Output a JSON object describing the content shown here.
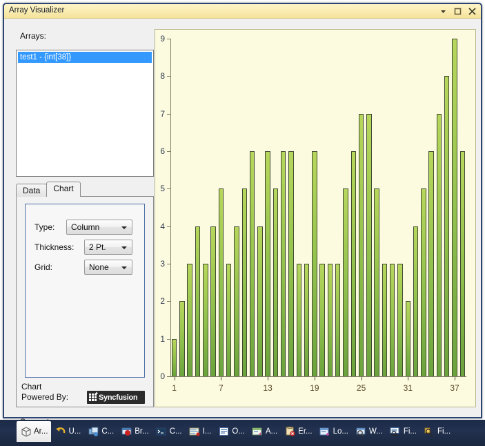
{
  "window": {
    "title": "Array Visualizer",
    "buttons": [
      {
        "name": "dropdown-arrow-icon",
        "label": "▾"
      },
      {
        "name": "maximize-icon",
        "label": "☐"
      },
      {
        "name": "close-icon",
        "label": "✕"
      }
    ]
  },
  "left": {
    "arrays_label": "Arrays:",
    "array_items": [
      "test1 - {int[38]}"
    ],
    "tabs": [
      {
        "label": "Data",
        "active": false
      },
      {
        "label": "Chart",
        "active": true
      }
    ],
    "form": {
      "type_label": "Type:",
      "type_value": "Column",
      "thickness_label": "Thickness:",
      "thickness_value": "2 Pt.",
      "grid_label": "Grid:",
      "grid_value": "None"
    },
    "powered_line1": "Chart",
    "powered_line2": "Powered By:",
    "logo_text": "Syncfusion",
    "support_label": "Support"
  },
  "chart_data": {
    "type": "bar",
    "title": "",
    "xlabel": "",
    "ylabel": "",
    "ylim": [
      0,
      9
    ],
    "xlim": [
      1,
      38
    ],
    "grid": false,
    "legend": false,
    "bar_color": "#9ec94f",
    "plot_background": "#fcfbdf",
    "y_ticks": [
      0,
      1,
      2,
      3,
      4,
      5,
      6,
      7,
      8,
      9
    ],
    "y_tick_labels": [
      "0",
      "1",
      "2",
      "3",
      "4",
      "5",
      "6",
      "7",
      "8",
      "9"
    ],
    "x_ticks": [
      1,
      7,
      13,
      19,
      25,
      31,
      37
    ],
    "x_tick_labels": [
      "1",
      "7",
      "13",
      "19",
      "25",
      "31",
      "37"
    ],
    "categories": [
      1,
      2,
      3,
      4,
      5,
      6,
      7,
      8,
      9,
      10,
      11,
      12,
      13,
      14,
      15,
      16,
      17,
      18,
      19,
      20,
      21,
      22,
      23,
      24,
      25,
      26,
      27,
      28,
      29,
      30,
      31,
      32,
      33,
      34,
      35,
      36,
      37,
      38
    ],
    "values": [
      1,
      2,
      3,
      4,
      3,
      4,
      5,
      3,
      4,
      5,
      6,
      4,
      6,
      5,
      6,
      6,
      3,
      3,
      6,
      3,
      3,
      3,
      5,
      6,
      7,
      7,
      5,
      3,
      3,
      3,
      2,
      4,
      5,
      6,
      7,
      8,
      9,
      6
    ]
  },
  "taskbar": {
    "items": [
      {
        "label": "Ar...",
        "icon": "cube-icon",
        "active": true
      },
      {
        "label": "U...",
        "icon": "undo-icon",
        "active": false
      },
      {
        "label": "C...",
        "icon": "cascade-windows-icon",
        "active": false
      },
      {
        "label": "Br...",
        "icon": "breakpoint-icon",
        "active": false
      },
      {
        "label": "C...",
        "icon": "console-icon",
        "active": false
      },
      {
        "label": "I...",
        "icon": "immediate-window-icon",
        "active": false
      },
      {
        "label": "O...",
        "icon": "output-window-icon",
        "active": false
      },
      {
        "label": "A...",
        "icon": "autos-window-icon",
        "active": false
      },
      {
        "label": "Er...",
        "icon": "error-list-icon",
        "active": false
      },
      {
        "label": "Lo...",
        "icon": "locals-window-icon",
        "active": false
      },
      {
        "label": "W...",
        "icon": "watch-window-icon",
        "active": false
      },
      {
        "label": "Fi...",
        "icon": "find-results-icon",
        "active": false
      },
      {
        "label": "Fi...",
        "icon": "find-symbol-icon",
        "active": false
      }
    ]
  }
}
